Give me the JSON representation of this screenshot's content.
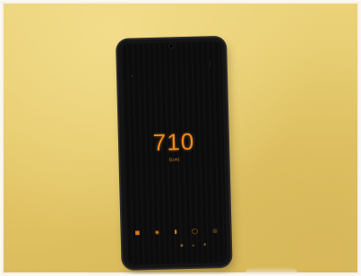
{
  "scene": {
    "background_color": "#e4c768",
    "phone": {
      "status_left": "",
      "status_right": "",
      "reading_value": "710",
      "reading_unit": "(Lux)",
      "accent_color": "#f08a1e",
      "icons": {
        "back": "back-arrow-icon",
        "more": "more-menu-icon",
        "bottom_row": [
          "stop-icon",
          "settings-icon",
          "pause-icon",
          "refresh-icon",
          "mode-icon"
        ],
        "bottom_row_2": [
          "chart-icon",
          "share-icon",
          "flash-icon"
        ]
      }
    }
  }
}
